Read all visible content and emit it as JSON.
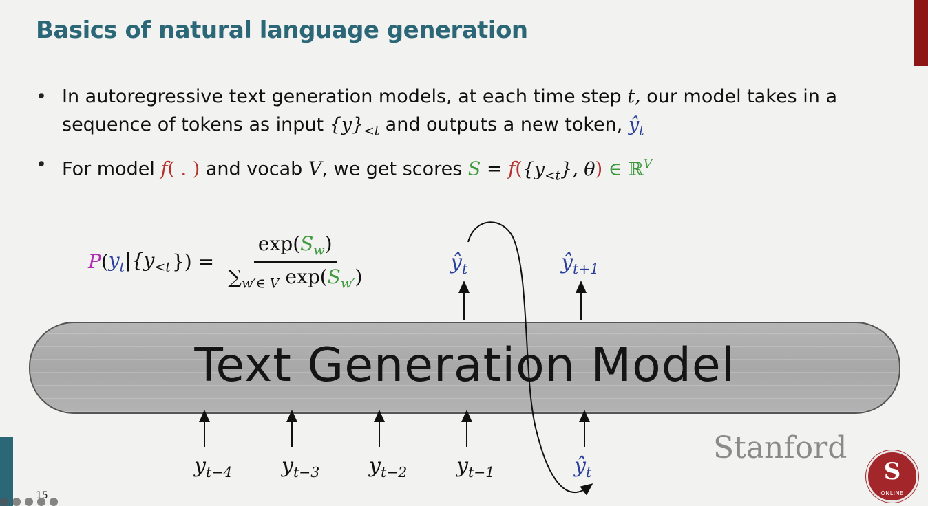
{
  "slide": {
    "title": "Basics of natural language generation",
    "page_number": "15"
  },
  "bullets": {
    "b1_line1_a": "In autoregressive text generation models, at each time step ",
    "b1_line1_t": "t,",
    "b1_line1_b": " our model takes in a",
    "b1_line2_a": "sequence of tokens as input ",
    "b1_line2_set": "{y}",
    "b1_line2_sub": "<t",
    "b1_line2_b": " and outputs a new token, ",
    "b1_line2_hat": "ŷ",
    "b1_line2_hat_sub": "t",
    "b2_a": "For model ",
    "b2_f": "f",
    "b2_f_args": "( . )",
    "b2_b": " and vocab ",
    "b2_V": "V",
    "b2_c": ", we get scores ",
    "b2_S": "S",
    "b2_eq": " = ",
    "b2_f2": "f",
    "b2_open": "(",
    "b2_set": "{y",
    "b2_set_sub": "<t",
    "b2_set_close": "}, θ",
    "b2_close": ")",
    "b2_in": " ∈ ℝ",
    "b2_sup": "V"
  },
  "formula": {
    "P": "P",
    "lhs_open": "(",
    "lhs_y": "y",
    "lhs_y_sub": "t",
    "lhs_rest": "|{y",
    "lhs_rest_sub": "<t",
    "lhs_close": "}) =",
    "num_a": "exp(",
    "num_S": "S",
    "num_S_sub": "w",
    "num_b": ")",
    "den_sum": "∑",
    "den_sub": "w′∈ V",
    "den_a": " exp(",
    "den_S": "S",
    "den_S_sub": "w′",
    "den_b": ")"
  },
  "model": {
    "label": "Text Generation Model"
  },
  "tokens": {
    "inputs": [
      {
        "base": "y",
        "sub": "t−4"
      },
      {
        "base": "y",
        "sub": "t−3"
      },
      {
        "base": "y",
        "sub": "t−2"
      },
      {
        "base": "y",
        "sub": "t−1"
      },
      {
        "base": "ŷ",
        "sub": "t"
      }
    ],
    "outputs": [
      {
        "base": "ŷ",
        "sub": "t"
      },
      {
        "base": "ŷ",
        "sub": "t+1"
      }
    ]
  },
  "branding": {
    "wordmark": "Stanford",
    "seal_letter": "S",
    "seal_text": "ONLINE"
  },
  "colors": {
    "title": "#2b6776",
    "accent_red": "#8c1515",
    "function_red": "#b5312b",
    "score_green": "#3f9a3f",
    "token_blue": "#2a3f9c",
    "prob_magenta": "#b22ab8"
  }
}
